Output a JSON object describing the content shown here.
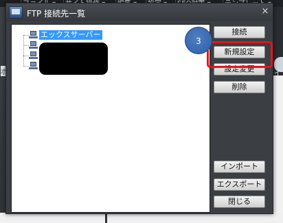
{
  "background_app": {
    "menu_items": [
      "ファイル ▾",
      "サイト操作 ▾",
      "編集 ▾",
      "設定 ▾",
      "SEO対策 ▾",
      "テンプレート ▾"
    ],
    "left_fragment": "ボ",
    "right_fragment": "イッ"
  },
  "dialog": {
    "title": "FTP 接続先一覧",
    "close_glyph": "×"
  },
  "tree": {
    "items": [
      {
        "label": "エックスサーバー",
        "selected": true
      },
      {
        "label": "",
        "redacted": true
      },
      {
        "label": "",
        "redacted": true
      },
      {
        "label": "",
        "redacted": true
      }
    ]
  },
  "buttons": {
    "connect": "接続",
    "new_setting": "新規設定",
    "change_setting": "設定変更",
    "delete": "削除",
    "import": "インポート",
    "export": "エクスポート",
    "close": "閉じる"
  },
  "annotation": {
    "step_number": "3",
    "highlight_color": "#e8141b",
    "badge_color": "#2d5ea8"
  }
}
